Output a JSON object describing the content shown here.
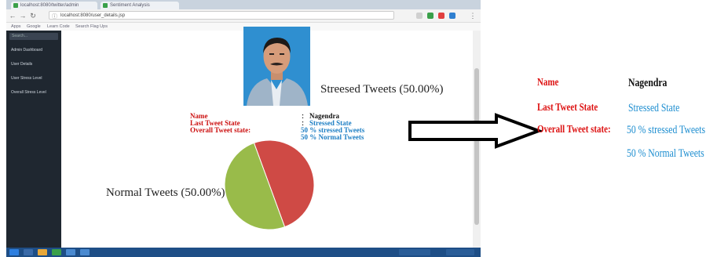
{
  "browser": {
    "tabs": [
      {
        "label": "localhost:8080/twitter/admin",
        "icon": "page-icon"
      },
      {
        "label": "Sentiment Analysis",
        "icon": "page-icon"
      }
    ],
    "url": "localhost:8080/user_details.jsp",
    "bookmarks": [
      "Apps",
      "Google",
      "Learn Code",
      "Search Flag Ups"
    ]
  },
  "sidebar": {
    "search_placeholder": "Search...",
    "items": [
      "Admin Dashboard",
      "User Details",
      "User Stress Level",
      "Overall Stress Level"
    ]
  },
  "profile": {
    "name_label": "Name",
    "separator": ":",
    "name_value": "Nagendra",
    "last_tweet_label": "Last Tweet State",
    "last_tweet_value": "Stressed State",
    "overall_label": "Overall Tweet state:",
    "overall_value_1": "50 % stressed Tweets",
    "overall_value_2": "50 % Normal Tweets"
  },
  "chart_data": {
    "type": "pie",
    "title": "",
    "labels": [
      "Streesed Tweets (50.00%)",
      "Normal Tweets (50.00%)"
    ],
    "values": [
      50,
      50
    ],
    "colors": [
      "#cf4a45",
      "#99bb4a"
    ]
  },
  "zoom_panel": {
    "name_label": "Name",
    "name_value": "Nagendra",
    "last_tweet_label": "Last Tweet State",
    "last_tweet_value": "Stressed State",
    "overall_label": "Overall Tweet state:",
    "overall_value_1": "50 % stressed Tweets",
    "overall_value_2": "50 % Normal Tweets"
  },
  "colors": {
    "label_red": "#dd1111",
    "value_blue": "#1e8ed0",
    "sidebar_bg": "#1f2730",
    "taskbar_bg": "#1e4e86"
  }
}
